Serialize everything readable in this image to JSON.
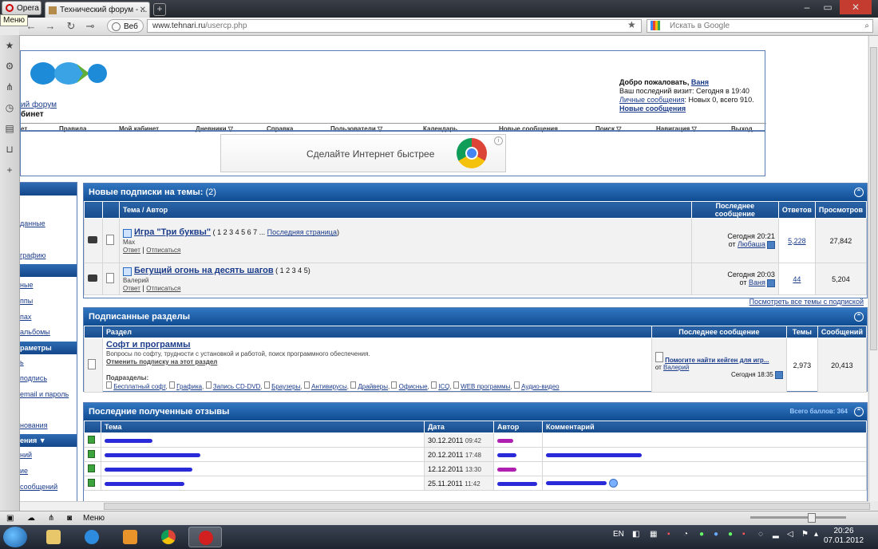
{
  "browser": {
    "menu_button": "Opera",
    "menu_tooltip": "Меню",
    "tab_title": "Технический форум - ...",
    "web_button": "Веб",
    "url_domain": "www.tehnari.ru",
    "url_path": "/usercp.php",
    "search_placeholder": "Искать в Google",
    "status_menu": "Меню"
  },
  "header": {
    "forum_link": "ий форум",
    "cabinet_label": "бинет",
    "welcome_text": "Добро пожаловать,",
    "username": "Ваня",
    "last_visit": "Ваш последний визит: Сегодня в 19:40",
    "pm_link": "Личные сообщения",
    "pm_stats": ": Новых 0, всего 910.",
    "new_messages_link": "Новые сообщения"
  },
  "nav": {
    "items": [
      "ет",
      "Правила",
      "Мой кабинет",
      "Дневники ▽",
      "Справка",
      "Пользователи ▽",
      "Календарь",
      "Новые сообщения",
      "Поиск ▽",
      "Навигация ▽",
      "Выход"
    ]
  },
  "ad": {
    "text": "Сделайте Интернет быстрее"
  },
  "leftnav": {
    "items": [
      "данные",
      "графию",
      "ные",
      "ппы",
      "пах",
      "альбомы",
      "ь",
      "подпись",
      "email и пароль",
      "нования",
      "ний",
      "ие",
      "сообщений"
    ],
    "headers": [
      "раметры",
      "ения ▼"
    ]
  },
  "threads": {
    "title": "Новые подписки на темы:",
    "count": "(2)",
    "columns": [
      "Тема / Автор",
      "Последнее сообщение",
      "Ответов",
      "Просмотров"
    ],
    "rows": [
      {
        "title": "Игра \"Три буквы\"",
        "pages": "( 1 2 3 4 5 6 7 ...",
        "last_page": "Последняя страница",
        "pages_end": ")",
        "author": "Max",
        "reply": "Ответ",
        "unsub": "Отписаться",
        "last_time": "Сегодня 20:21",
        "last_by_prefix": "от",
        "last_by": "Любаша",
        "replies": "5,228",
        "views": "27,842"
      },
      {
        "title": "Бегущий огонь на десять шагов",
        "pages": "( 1 2 3 4 5)",
        "last_page": "",
        "pages_end": "",
        "author": "Валерий",
        "reply": "Ответ",
        "unsub": "Отписаться",
        "last_time": "Сегодня 20:03",
        "last_by_prefix": "от",
        "last_by": "Ваня",
        "replies": "44",
        "views": "5,204"
      }
    ],
    "view_all": "Посмотреть все темы с подпиской"
  },
  "sections": {
    "title": "Подписанные разделы",
    "columns": [
      "Раздел",
      "Последнее сообщение",
      "Темы",
      "Сообщений"
    ],
    "row": {
      "name": "Софт и программы",
      "desc": "Вопросы по софту, трудности с установкой и работой, поиск программного обеспечения.",
      "unsub": "Отменить подписку на этот раздел",
      "subsections_label": "Подразделы:",
      "subsections": [
        "Бесплатный софт",
        "Графика",
        "Запись CD-DVD",
        "Браузеры",
        "Антивирусы",
        "Драйверы",
        "Офисные",
        "ICQ",
        "WEB программы",
        "Аудио-видео"
      ],
      "last_title": "Помогите найти кейген для игр...",
      "last_by_prefix": "от",
      "last_by": "Валерий",
      "last_time": "Сегодня 18:35",
      "topics": "2,973",
      "posts": "20,413"
    }
  },
  "reviews": {
    "title": "Последние полученные отзывы",
    "score_label": "Всего баллов: 364",
    "columns": [
      "Тема",
      "Дата",
      "Автор",
      "Комментарий"
    ],
    "rows": [
      {
        "date": "30.12.2011",
        "time": "09:42"
      },
      {
        "date": "20.12.2011",
        "time": "17:48"
      },
      {
        "date": "12.12.2011",
        "time": "13:30"
      },
      {
        "date": "25.11.2011",
        "time": "11:42"
      }
    ]
  },
  "taskbar": {
    "lang": "EN",
    "time": "20:26",
    "date": "07.01.2012"
  }
}
